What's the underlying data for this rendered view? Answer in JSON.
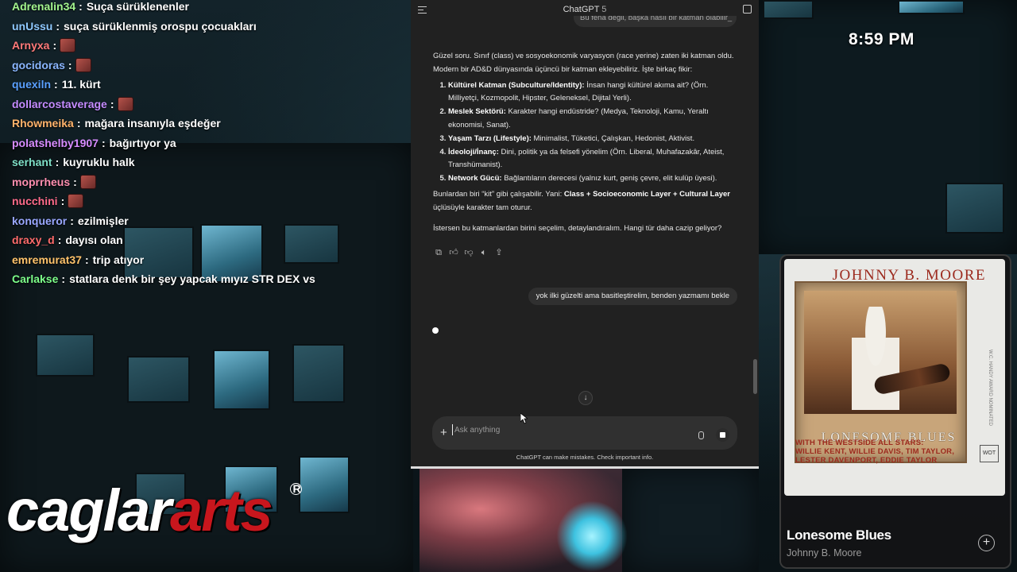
{
  "chat": {
    "messages": [
      {
        "user": "Adrenalin34",
        "color": "#a3f58e",
        "text": "Suça sürüklenenler",
        "emote": false
      },
      {
        "user": "unUssu",
        "color": "#8fc9ff",
        "text": "suça sürüklenmiş orospu çocuakları",
        "emote": false
      },
      {
        "user": "Arnyxa",
        "color": "#ff7a7a",
        "text": "",
        "emote": true
      },
      {
        "user": "gocidoras",
        "color": "#8ab6ff",
        "text": "",
        "emote": true
      },
      {
        "user": "quexiln",
        "color": "#5aa0ff",
        "text": "11. kürt",
        "emote": false
      },
      {
        "user": "dollarcostaverage",
        "color": "#c48bff",
        "text": "",
        "emote": true
      },
      {
        "user": "Rhowmeika",
        "color": "#ffb36b",
        "text": "mağara insanıyla eşdeğer",
        "emote": false
      },
      {
        "user": "polatshelby1907",
        "color": "#d88cff",
        "text": "bağırtıyor ya",
        "emote": false
      },
      {
        "user": "serhant",
        "color": "#7fe0c8",
        "text": "kuyruklu halk",
        "emote": false
      },
      {
        "user": "moprrheus",
        "color": "#ff8fb0",
        "text": "",
        "emote": true
      },
      {
        "user": "nucchini",
        "color": "#ff6b8a",
        "text": "",
        "emote": true
      },
      {
        "user": "konqueror",
        "color": "#9aa7ff",
        "text": "ezilmişler",
        "emote": false
      },
      {
        "user": "draxy_d",
        "color": "#ff6b6b",
        "text": "dayısı olan",
        "emote": false
      },
      {
        "user": "emremurat37",
        "color": "#ffc36b",
        "text": "trip atıyor",
        "emote": false
      },
      {
        "user": "Carlakse",
        "color": "#7dff8a",
        "text": "statlara denk bir şey yapcak mıyız STR DEX vs",
        "emote": false
      }
    ]
  },
  "clock": "8:59 PM",
  "logo": {
    "part1": "caglar",
    "part2": "arts",
    "reg": "R"
  },
  "gpt": {
    "title": "ChatGPT",
    "version": "5",
    "prev_message": "Bu fena değil, başka nasıl bir katman olabilir_",
    "answer": {
      "intro": "Güzel soru. Sınıf (class) ve sosyoekonomik varyasyon (race yerine) zaten iki katman oldu. Modern bir AD&D dünyasında üçüncü bir katman ekleyebiliriz. İşte birkaç fikir:",
      "items": [
        {
          "title": "Kültürel Katman (Subculture/Identity):",
          "text": "İnsan hangi kültürel akıma ait? (Örn. Milliyetçi, Kozmopolit, Hipster, Geleneksel, Dijital Yerli)."
        },
        {
          "title": "Meslek Sektörü:",
          "text": "Karakter hangi endüstride? (Medya, Teknoloji, Kamu, Yeraltı ekonomisi, Sanat)."
        },
        {
          "title": "Yaşam Tarzı (Lifestyle):",
          "text": "Minimalist, Tüketici, Çalışkan, Hedonist, Aktivist."
        },
        {
          "title": "İdeoloji/İnanç:",
          "text": "Dini, politik ya da felsefi yönelim (Örn. Liberal, Muhafazakâr, Ateist, Transhümanist)."
        },
        {
          "title": "Network Gücü:",
          "text": "Bağlantıların derecesi (yalnız kurt, geniş çevre, elit kulüp üyesi)."
        }
      ],
      "combo_pre": "Bunlardan biri “kit” gibi çalışabilir. Yani: ",
      "combo_bold": "Class + Socioeconomic Layer + Cultural Layer",
      "combo_post": " üçlüsüyle karakter tam oturur.",
      "closing": "İstersen bu katmanlardan birini seçelim, detaylandıralım. Hangi tür daha cazip geliyor?"
    },
    "user_message": "yok ilki güzelti ama basitleştirelim, benden yazmamı bekle",
    "composer_placeholder": "Ask anything",
    "disclaimer": "ChatGPT can make mistakes. Check important info."
  },
  "music": {
    "album_artist": "JOHNNY B. MOORE",
    "album_title": "LONESOME BLUES",
    "album_credits": [
      "WITH THE WESTSIDE ALL STARS:",
      "WILLIE KENT, WILLIE DAVIS, TIM TAYLOR,",
      "LESTER DAVENPORT, EDDIE TAYLOR"
    ],
    "album_side": "W.C. HANDY AWARD NOMINATED",
    "album_stamp": "WOT",
    "track_title": "Lonesome Blues",
    "track_artist": "Johnny B. Moore"
  }
}
